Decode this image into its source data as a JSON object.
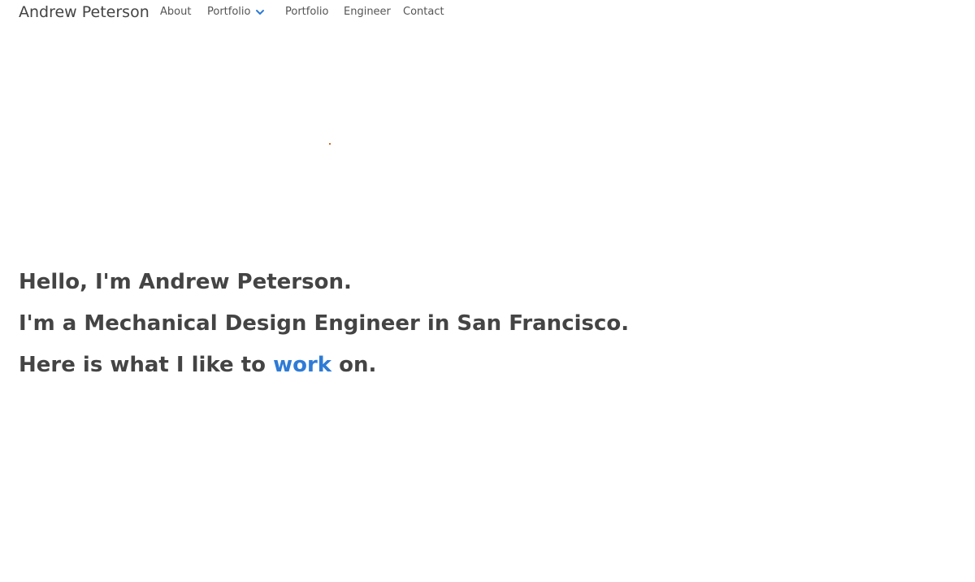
{
  "navbar": {
    "brand": "Andrew Peterson",
    "links": {
      "about": "About",
      "portfolio_dropdown": "Portfolio",
      "portfolio": "Portfolio",
      "engineer": "Engineer",
      "contact": "Contact"
    },
    "dropdown_icon": "chevron-down-icon",
    "accent_color": "#2e7bd6"
  },
  "hero": {
    "line1": "Hello, I'm Andrew Peterson.",
    "line2": "I'm a Mechanical Design Engineer in San Francisco.",
    "line3_prefix": "Here is what I like to",
    "line3_link": "work",
    "line3_suffix": "on."
  },
  "colors": {
    "text": "#444444",
    "link": "#2e7bd6",
    "dot": "#d2691e"
  }
}
